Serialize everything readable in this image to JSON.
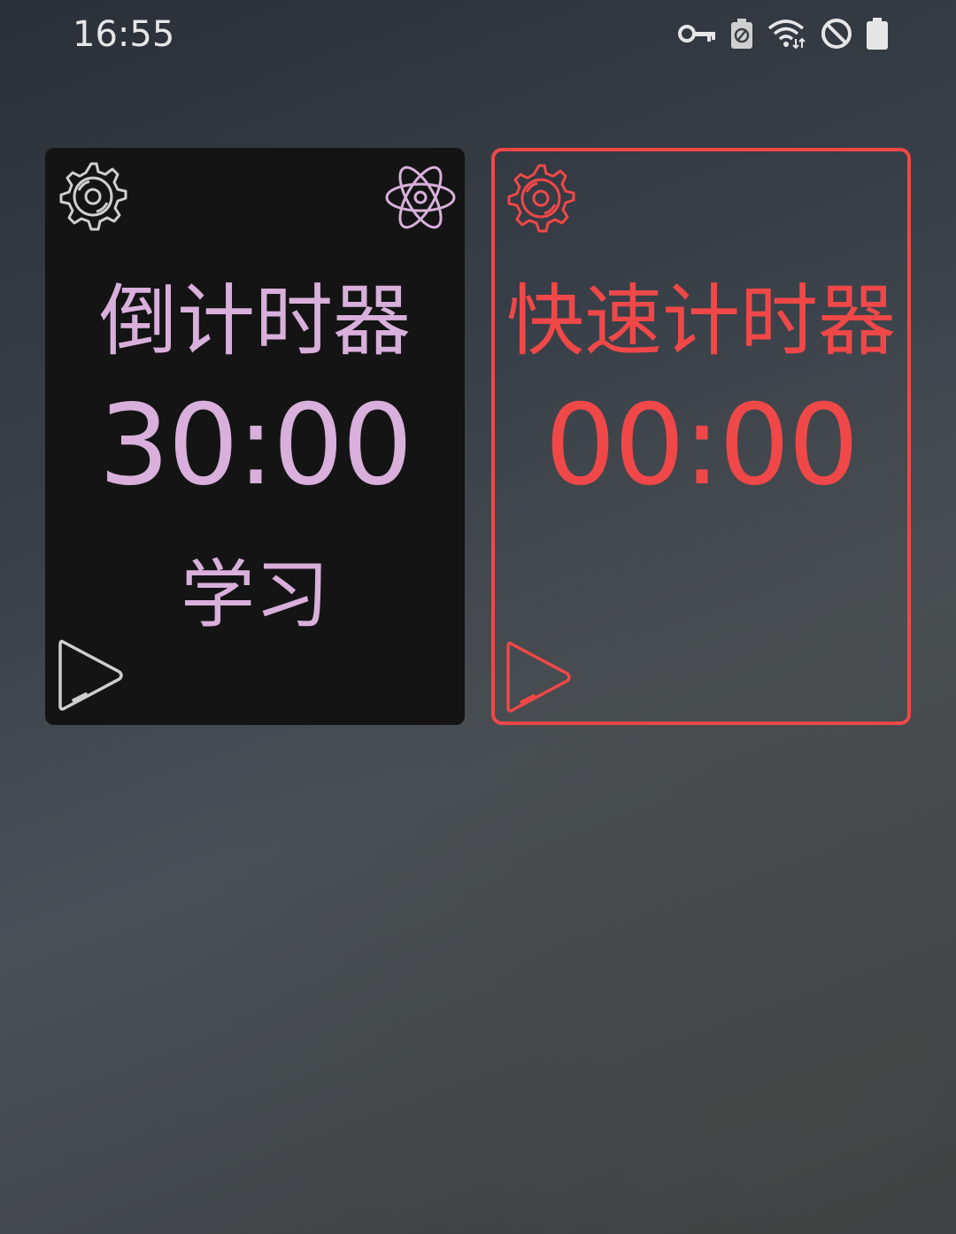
{
  "status_bar": {
    "time": "16:55",
    "icons": [
      "vpn-key-icon",
      "battery-saver-icon",
      "wifi-icon",
      "do-not-disturb-icon",
      "battery-icon"
    ]
  },
  "widgets": [
    {
      "title": "倒计时器",
      "time": "30:00",
      "label": "学习",
      "icons": [
        "gear-icon",
        "atom-icon",
        "play-icon"
      ],
      "accent": "#d8b0db"
    },
    {
      "title": "快速计时器",
      "time": "00:00",
      "icons": [
        "gear-icon",
        "play-icon"
      ],
      "accent": "#f04848"
    }
  ]
}
